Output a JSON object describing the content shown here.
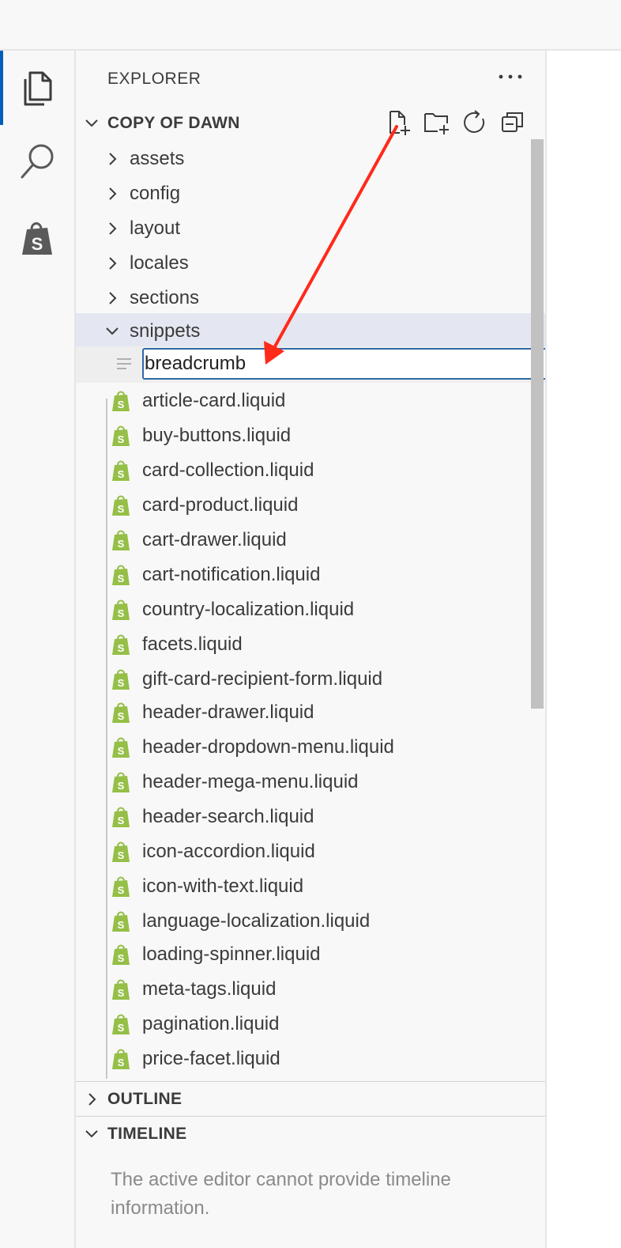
{
  "explorer": {
    "title": "EXPLORER",
    "root_section": "COPY OF DAWN",
    "folders": [
      {
        "label": "assets",
        "expanded": false
      },
      {
        "label": "config",
        "expanded": false
      },
      {
        "label": "layout",
        "expanded": false
      },
      {
        "label": "locales",
        "expanded": false
      },
      {
        "label": "sections",
        "expanded": false
      },
      {
        "label": "snippets",
        "expanded": true
      }
    ],
    "new_file_input_value": "breadcrumb",
    "files": [
      "article-card.liquid",
      "buy-buttons.liquid",
      "card-collection.liquid",
      "card-product.liquid",
      "cart-drawer.liquid",
      "cart-notification.liquid",
      "country-localization.liquid",
      "facets.liquid",
      "gift-card-recipient-form.liquid",
      "header-drawer.liquid",
      "header-dropdown-menu.liquid",
      "header-mega-menu.liquid",
      "header-search.liquid",
      "icon-accordion.liquid",
      "icon-with-text.liquid",
      "language-localization.liquid",
      "loading-spinner.liquid",
      "meta-tags.liquid",
      "pagination.liquid",
      "price-facet.liquid"
    ]
  },
  "outline": {
    "title": "OUTLINE"
  },
  "timeline": {
    "title": "TIMELINE",
    "message": "The active editor cannot provide timeline information."
  },
  "icons": {
    "activity": [
      "files-icon",
      "search-icon",
      "shopify-icon"
    ],
    "toolbar": [
      "new-file-icon",
      "new-folder-icon",
      "refresh-icon",
      "collapse-all-icon"
    ]
  },
  "colors": {
    "accent": "#005fb8",
    "selected_row": "#e4e6f1",
    "shopify_green": "#95bf47",
    "annotation_arrow": "#ff2a1a"
  }
}
